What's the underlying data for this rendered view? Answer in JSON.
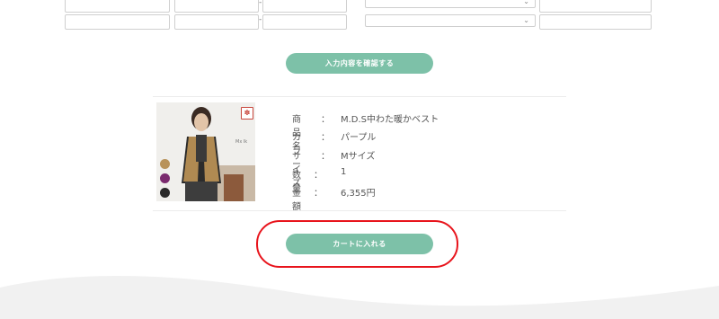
{
  "form": {
    "confirm_button": "入力内容を確認する"
  },
  "product": {
    "rows": [
      {
        "label": "商品名",
        "colon": "：",
        "value": "M.D.S中わた暖かベスト"
      },
      {
        "label": "カラー",
        "colon": "：",
        "value": "パープル"
      },
      {
        "label": "サイズ",
        "colon": "：",
        "value": "Mサイズ"
      },
      {
        "label": "数量",
        "colon": "：",
        "value": "1"
      },
      {
        "label": "金額",
        "colon": "：",
        "value": "6,355円"
      }
    ],
    "swatches": [
      "#b8925a",
      "#7a2a6e",
      "#2a2a2a"
    ],
    "badge_icon": "maple-leaf-icon"
  },
  "cart": {
    "add_button": "カートに入れる"
  },
  "colors": {
    "accent": "#7dc1a8",
    "highlight": "#e8141c"
  }
}
